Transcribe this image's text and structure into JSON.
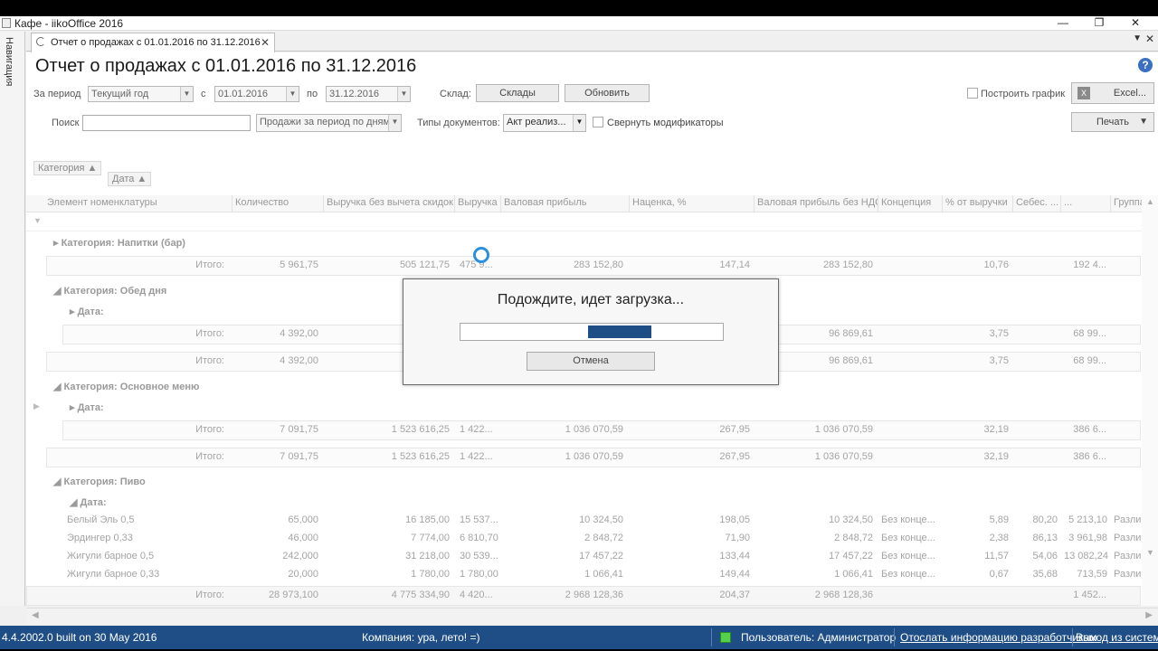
{
  "window": {
    "title": "Кафе - iikoOffice 2016",
    "minimize": "—",
    "maximize": "❐",
    "close": "✕"
  },
  "leftnav": {
    "label": "Навигация"
  },
  "tab": {
    "label": "Отчет о продажах с 01.01.2016 по 31.12.2016",
    "close": "✕"
  },
  "report": {
    "title": "Отчет о продажах с 01.01.2016 по 31.12.2016",
    "period_label": "За период",
    "period_value": "Текущий год",
    "from_label": "с",
    "from_value": "01.01.2016",
    "to_label": "по",
    "to_value": "31.12.2016",
    "store_label": "Склад:",
    "store_button": "Склады",
    "refresh_button": "Обновить",
    "build_chart_label": "Построить график",
    "excel_button": "Excel...",
    "search_label": "Поиск",
    "search_value": "",
    "report_type_value": "Продажи за период по дням",
    "doc_types_label": "Типы документов:",
    "doc_types_value": "Акт реализ...",
    "collapse_modifiers_label": "Свернуть модификаторы",
    "print_button": "Печать"
  },
  "grid": {
    "group_chips": [
      "Категория",
      "Дата"
    ],
    "columns": [
      "Элемент номенклатуры",
      "Количество",
      "Выручка без вычета скидок",
      "Выручка",
      "Валовая прибыль",
      "Наценка, %",
      "Валовая прибыль без НДС",
      "Концепция",
      "% от выручки",
      "Себес. ...",
      "...",
      "Группа"
    ],
    "groups": {
      "drinks": "Категория: Напитки (бар)",
      "lunch": "Категория: Обед дня",
      "main": "Категория: Основное меню",
      "beer": "Категория: Пиво",
      "date": "Дата:"
    },
    "total_label": "Итого:",
    "totals": {
      "drinks": [
        "5 961,75",
        "505 121,75",
        "475 9...",
        "283 152,80",
        "147,14",
        "283 152,80",
        "10,76",
        "192 4..."
      ],
      "lunch_inner": [
        "4 392,00",
        "96 869,61",
        "3,75",
        "68 99..."
      ],
      "lunch": [
        "4 392,00",
        "96 869,61",
        "3,75",
        "68 99..."
      ],
      "main_inner": [
        "7 091,75",
        "1 523 616,25",
        "1 422...",
        "1 036 070,59",
        "267,95",
        "1 036 070,59",
        "32,19",
        "386 6..."
      ],
      "main": [
        "7 091,75",
        "1 523 616,25",
        "1 422...",
        "1 036 070,59",
        "267,95",
        "1 036 070,59",
        "32,19",
        "386 6..."
      ],
      "grand": [
        "28 973,100",
        "4 775 334,90",
        "4 420...",
        "2 968 128,36",
        "204,37",
        "2 968 128,36",
        "1 452..."
      ]
    },
    "beer_rows": [
      [
        "Белый Эль 0,5",
        "65,000",
        "16 185,00",
        "15 537...",
        "10 324,50",
        "198,05",
        "10 324,50",
        "Без конце...",
        "5,89",
        "80,20",
        "5 213,10",
        "Разлив"
      ],
      [
        "Эрдингер 0,33",
        "46,000",
        "7 774,00",
        "6 810,70",
        "2 848,72",
        "71,90",
        "2 848,72",
        "Без конце...",
        "2,38",
        "86,13",
        "3 961,98",
        "Разлив"
      ],
      [
        "Жигули барное 0,5",
        "242,000",
        "31 218,00",
        "30 539...",
        "17 457,22",
        "133,44",
        "17 457,22",
        "Без конце...",
        "11,57",
        "54,06",
        "13 082,24",
        "Разлив"
      ],
      [
        "Жигули барное 0,33",
        "20,000",
        "1 780,00",
        "1 780,00",
        "1 066,41",
        "149,44",
        "1 066,41",
        "Без конце...",
        "0,67",
        "35,68",
        "713,59",
        "Разлив"
      ]
    ]
  },
  "dialog": {
    "message": "Подождите, идет загрузка...",
    "progress_start": 0.485,
    "progress_width": 0.24,
    "cancel": "Отмена"
  },
  "status": {
    "version": "4.4.2002.0 built on 30 May 2016",
    "company": "Компания: ура, лето! =)",
    "user": "Пользователь: Администратор",
    "send_info": "Отослать информацию разработчикам",
    "logout": "Выход из системы"
  }
}
